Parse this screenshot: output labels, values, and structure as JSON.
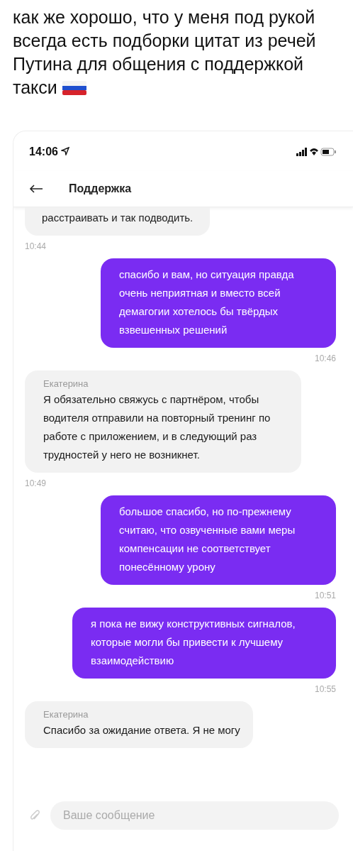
{
  "post": {
    "text": "как же хорошо, что у меня под рукой всегда есть подборки цитат из речей Путина для общения с поддержкой такси"
  },
  "phone": {
    "status_bar": {
      "time": "14:06"
    },
    "header": {
      "title": "Поддержка"
    },
    "messages": [
      {
        "kind": "incoming",
        "text": "расстраивать и так подводить.",
        "time": "10:44"
      },
      {
        "kind": "outgoing",
        "text": "спасибо и вам, но ситуация правда очень неприятная и вместо всей демагогии хотелось бы твёрдых взвешенных решений",
        "time": "10:46"
      },
      {
        "kind": "incoming",
        "author": "Екатерина",
        "text": "Я обязательно свяжусь с партнёром, чтобы водителя отправили на повторный тренинг по работе с приложением, и в следующий раз трудностей у него не возникнет.",
        "time": "10:49"
      },
      {
        "kind": "outgoing",
        "text": "большое спасибо, но по-прежнему считаю, что озвученные вами меры компенсации не соответствует понесённому урону",
        "time": "10:51"
      },
      {
        "kind": "outgoing",
        "text": "я пока не вижу конструктивных сигналов, которые могли бы привести к лучшему взаимодействию",
        "time": "10:55"
      },
      {
        "kind": "incoming",
        "author": "Екатерина",
        "text": "Спасибо за ожидание ответа. Я не могу"
      }
    ],
    "composer": {
      "placeholder": "Ваше сообщение"
    }
  }
}
